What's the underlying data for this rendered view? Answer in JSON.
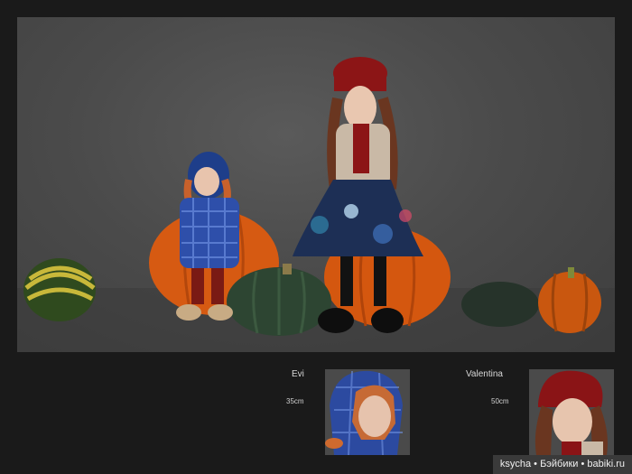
{
  "dolls": [
    {
      "name": "Evi",
      "size": "35cm"
    },
    {
      "name": "Valentina",
      "size": "50cm"
    }
  ],
  "watermark": {
    "text": "ksycha • Бэйбики • babiki.ru"
  }
}
